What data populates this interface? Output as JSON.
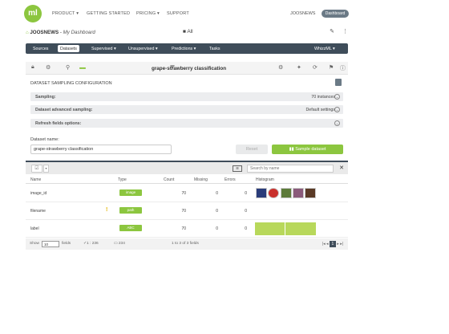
{
  "topbar": {
    "logo": "ml",
    "nav": [
      "PRODUCT ▾",
      "GETTING STARTED",
      "PRICING ▾",
      "SUPPORT"
    ],
    "user": "JOOSNEWS",
    "dashboard_btn": "Dashboard"
  },
  "breadcrumb": {
    "org": "JOOSNEWS",
    "sep": " - ",
    "page": "My Dashboard",
    "folder": "All"
  },
  "mainnav": [
    "Sources",
    "Datasets",
    "Supervised ▾",
    "Unsupervised ▾",
    "Predictions ▾",
    "Tasks",
    "WhizzML ▾"
  ],
  "dataset": {
    "name": "grape-strawberry classification"
  },
  "config": {
    "title": "DATASET SAMPLING CONFIGURATION",
    "rows": [
      {
        "label": "Sampling:",
        "value": "70 instances"
      },
      {
        "label": "Dataset advanced sampling:",
        "value": "Default settings"
      },
      {
        "label": "Refresh fields options:",
        "value": ""
      }
    ],
    "name_label": "Dataset name:",
    "name_value": "grape-strawberry classification",
    "reset": "Reset",
    "sample": "Sample dataset"
  },
  "fields": {
    "search_placeholder": "Search by name",
    "columns": [
      "Name",
      "Type",
      "Count",
      "Missing",
      "Errors",
      "Histogram"
    ],
    "rows": [
      {
        "name": "image_id",
        "type": "image",
        "count": "70",
        "missing": "0",
        "errors": "0"
      },
      {
        "name": "filename",
        "type": "path",
        "count": "70",
        "missing": "0",
        "errors": "0"
      },
      {
        "name": "label",
        "type": "ABC",
        "count": "70",
        "missing": "0",
        "errors": "0"
      }
    ],
    "footer": {
      "show": "Show",
      "page_size": "10",
      "fields": "fields",
      "count_a": "1 : 236",
      "count_b": "234",
      "range": "1 to 3 of 3 fields",
      "page": "1"
    }
  },
  "colors": {
    "accent": "#8cc63f",
    "nav": "#3f4d5a"
  }
}
